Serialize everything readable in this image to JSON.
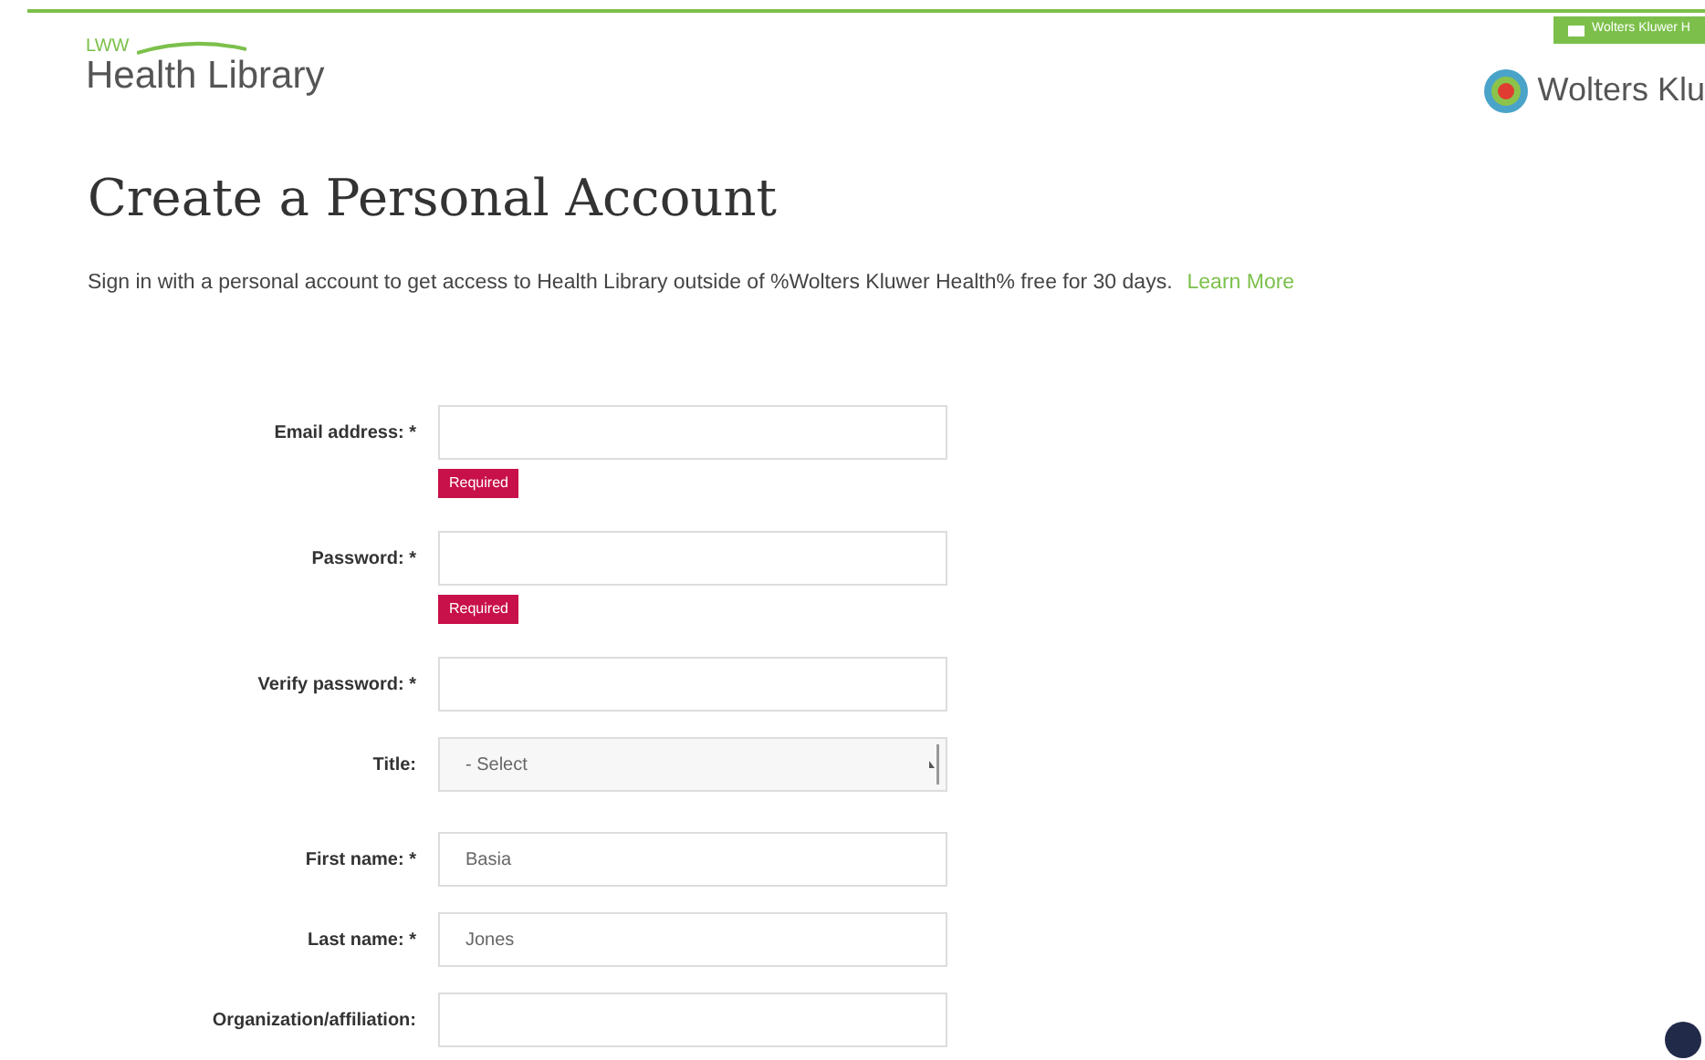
{
  "header": {
    "logo_small": "LWW",
    "logo": "Health Library",
    "brand": "Wolters Klu",
    "top_tab": "Wolters Kluwer H"
  },
  "title": "Create a Personal Account",
  "intro": {
    "text": "Sign in with a personal account to get access to Health Library outside of %Wolters Kluwer Health% free for 30 days.",
    "link": "Learn More"
  },
  "fields": [
    {
      "kind": "input",
      "label": "Email address: *",
      "error": "Required"
    },
    {
      "kind": "input",
      "label": "Password: *",
      "error": "Required"
    },
    {
      "kind": "input",
      "label": "Verify password: *"
    },
    {
      "kind": "select",
      "label": "Title:",
      "value": "- Select"
    },
    {
      "kind": "input",
      "label": "First name: *",
      "value": "Basia"
    },
    {
      "kind": "input",
      "label": "Last name: *",
      "value": "Jones"
    },
    {
      "kind": "input",
      "label": "Organization/affiliation:"
    }
  ]
}
